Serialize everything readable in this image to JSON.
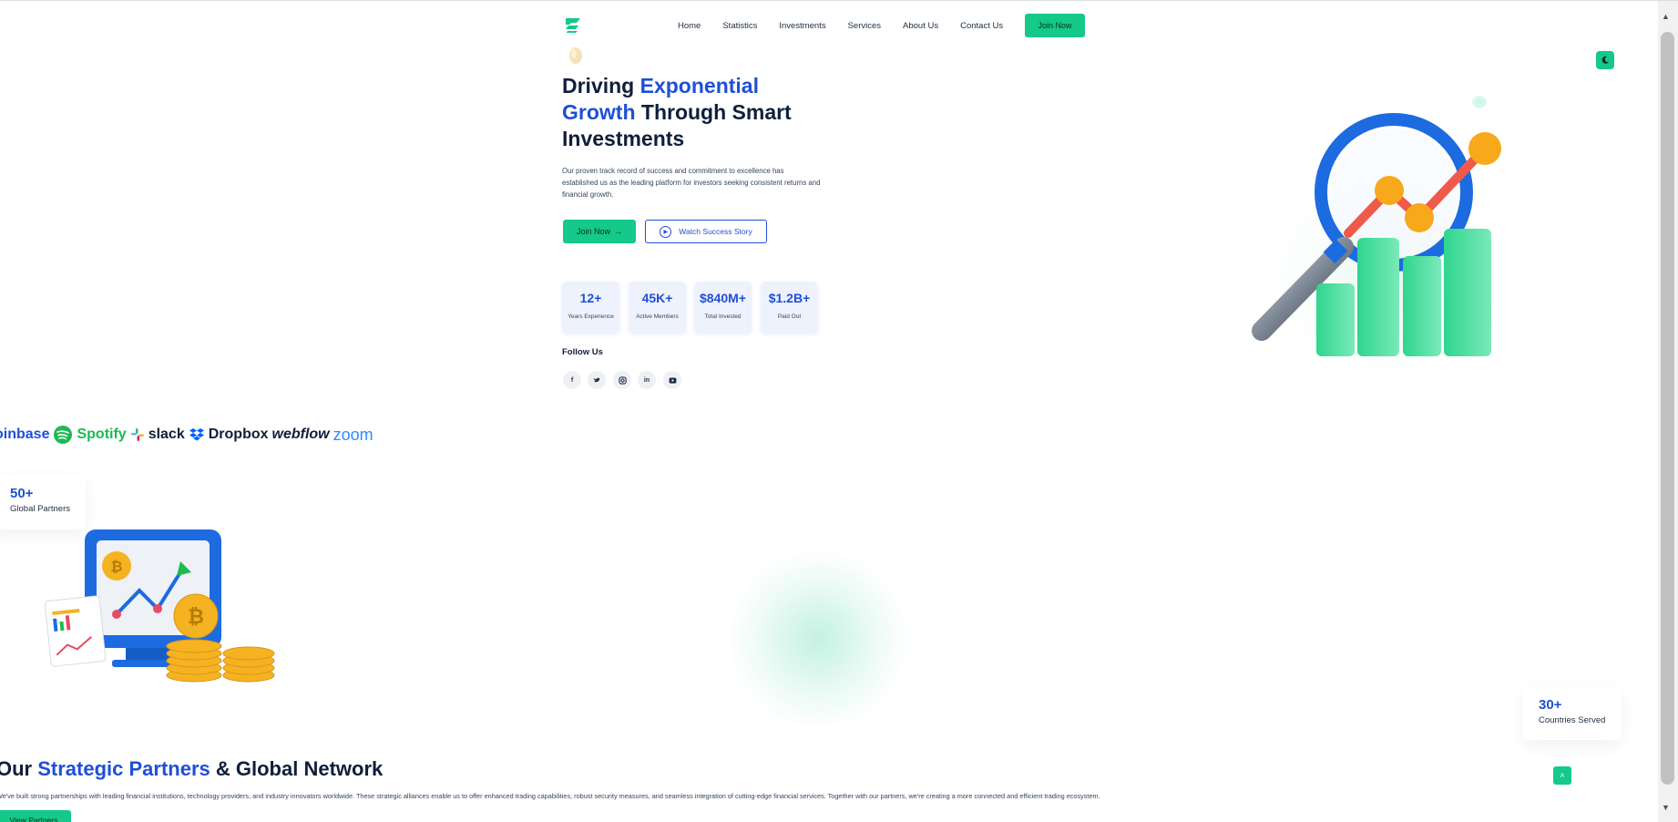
{
  "nav": {
    "items": [
      "Home",
      "Statistics",
      "Investments",
      "Services",
      "About Us",
      "Contact Us"
    ],
    "join_label": "Join Now"
  },
  "hero": {
    "title_part1": "Driving ",
    "title_accent1": "Exponential",
    "title_accent2": "Growth",
    "title_part2": " Through Smart Investments",
    "description": "Our proven track record of success and commitment to excellence has established us as the leading platform for investors seeking consistent returns and financial growth.",
    "join_label": "Join Now",
    "watch_label": "Watch Success Story"
  },
  "stats": [
    {
      "value": "12+",
      "label": "Years Experience"
    },
    {
      "value": "45K+",
      "label": "Active Members"
    },
    {
      "value": "$840M+",
      "label": "Total Invested"
    },
    {
      "value": "$1.2B+",
      "label": "Paid Out"
    }
  ],
  "follow": {
    "title": "Follow Us",
    "icons": [
      "facebook-icon",
      "twitter-icon",
      "instagram-icon",
      "linkedin-icon",
      "youtube-icon"
    ]
  },
  "brands": [
    "oinbase",
    "Spotify",
    "slack",
    "Dropbox",
    "webflow",
    "zoom"
  ],
  "partners_card": {
    "number": "50+",
    "text": "Global Partners"
  },
  "countries_card": {
    "number": "30+",
    "text": "Countries Served"
  },
  "strategic": {
    "part1": "Our ",
    "accent": "Strategic Partners",
    "part2": " & Global Network",
    "description": "We've built strong partnerships with leading financial institutions, technology providers, and industry innovators worldwide. These strategic alliances enable us to offer enhanced trading capabilities, robust security measures, and seamless integration of cutting-edge financial services. Together with our partners, we're creating a more connected and efficient trading ecosystem.",
    "button": "View Partners"
  },
  "colors": {
    "accent_blue": "#1f4fd8",
    "accent_green": "#14c98a",
    "text_dark": "#0f1f3a"
  }
}
